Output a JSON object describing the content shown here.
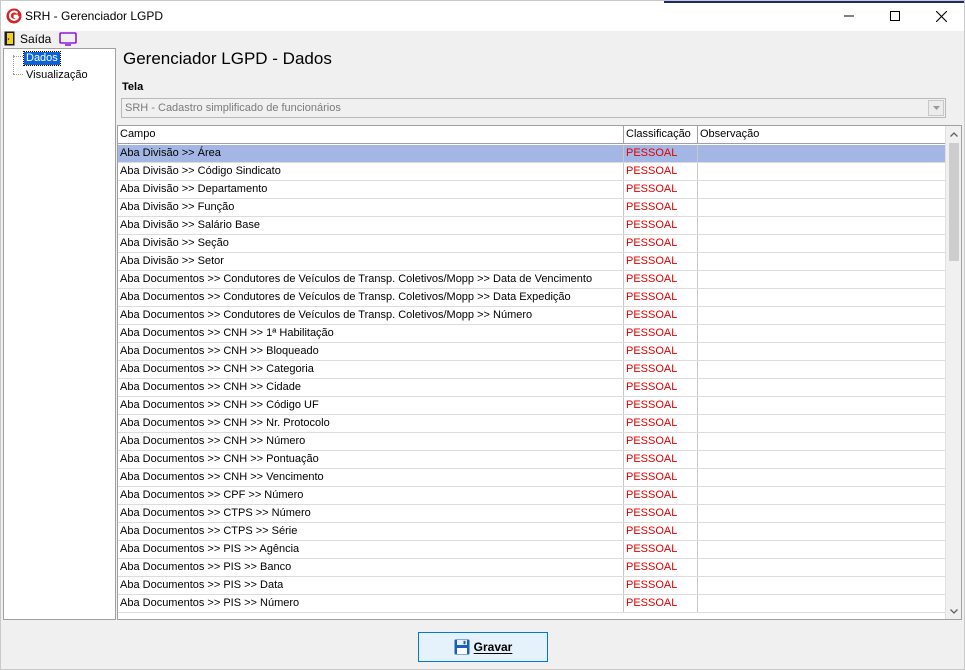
{
  "window": {
    "title": "SRH - Gerenciador LGPD"
  },
  "menu": {
    "exit_label": "Saída"
  },
  "tree": {
    "items": [
      "Dados",
      "Visualização"
    ],
    "selected": "Dados"
  },
  "main": {
    "title": "Gerenciador LGPD - Dados",
    "screen_label": "Tela",
    "screen_value": "SRH - Cadastro simplificado de funcionários"
  },
  "grid": {
    "columns": [
      "Campo",
      "Classificação",
      "Observação"
    ],
    "rows": [
      {
        "campo": "Aba Divisão >> Área",
        "classificacao": "PESSOAL",
        "observacao": ""
      },
      {
        "campo": "Aba Divisão >> Código Sindicato",
        "classificacao": "PESSOAL",
        "observacao": ""
      },
      {
        "campo": "Aba Divisão >> Departamento",
        "classificacao": "PESSOAL",
        "observacao": ""
      },
      {
        "campo": "Aba Divisão >> Função",
        "classificacao": "PESSOAL",
        "observacao": ""
      },
      {
        "campo": "Aba Divisão >> Salário Base",
        "classificacao": "PESSOAL",
        "observacao": ""
      },
      {
        "campo": "Aba Divisão >> Seção",
        "classificacao": "PESSOAL",
        "observacao": ""
      },
      {
        "campo": "Aba Divisão >> Setor",
        "classificacao": "PESSOAL",
        "observacao": ""
      },
      {
        "campo": "Aba Documentos >>  Condutores de Veículos de Transp. Coletivos/Mopp >> Data de Vencimento",
        "classificacao": "PESSOAL",
        "observacao": ""
      },
      {
        "campo": "Aba Documentos >>  Condutores de Veículos de Transp. Coletivos/Mopp >> Data Expedição",
        "classificacao": "PESSOAL",
        "observacao": ""
      },
      {
        "campo": "Aba Documentos >>  Condutores de Veículos de Transp. Coletivos/Mopp >> Número",
        "classificacao": "PESSOAL",
        "observacao": ""
      },
      {
        "campo": "Aba Documentos >> CNH >> 1ª Habilitação",
        "classificacao": "PESSOAL",
        "observacao": ""
      },
      {
        "campo": "Aba Documentos >> CNH >> Bloqueado",
        "classificacao": "PESSOAL",
        "observacao": ""
      },
      {
        "campo": "Aba Documentos >> CNH >> Categoria",
        "classificacao": "PESSOAL",
        "observacao": ""
      },
      {
        "campo": "Aba Documentos >> CNH >> Cidade",
        "classificacao": "PESSOAL",
        "observacao": ""
      },
      {
        "campo": "Aba Documentos >> CNH >> Código UF",
        "classificacao": "PESSOAL",
        "observacao": ""
      },
      {
        "campo": "Aba Documentos >> CNH >> Nr. Protocolo",
        "classificacao": "PESSOAL",
        "observacao": ""
      },
      {
        "campo": "Aba Documentos >> CNH >> Número",
        "classificacao": "PESSOAL",
        "observacao": ""
      },
      {
        "campo": "Aba Documentos >> CNH >> Pontuação",
        "classificacao": "PESSOAL",
        "observacao": ""
      },
      {
        "campo": "Aba Documentos >> CNH >> Vencimento",
        "classificacao": "PESSOAL",
        "observacao": ""
      },
      {
        "campo": "Aba Documentos >> CPF >> Número",
        "classificacao": "PESSOAL",
        "observacao": ""
      },
      {
        "campo": "Aba Documentos >> CTPS >> Número",
        "classificacao": "PESSOAL",
        "observacao": ""
      },
      {
        "campo": "Aba Documentos >> CTPS >> Série",
        "classificacao": "PESSOAL",
        "observacao": ""
      },
      {
        "campo": "Aba Documentos >> PIS >> Agência",
        "classificacao": "PESSOAL",
        "observacao": ""
      },
      {
        "campo": "Aba Documentos >> PIS >> Banco",
        "classificacao": "PESSOAL",
        "observacao": ""
      },
      {
        "campo": "Aba Documentos >> PIS >> Data",
        "classificacao": "PESSOAL",
        "observacao": ""
      },
      {
        "campo": "Aba Documentos >> PIS >> Número",
        "classificacao": "PESSOAL",
        "observacao": ""
      }
    ],
    "selected_row": 0
  },
  "actions": {
    "save_label": "Gravar"
  },
  "colors": {
    "classification_text": "#e00000",
    "selected_row": "#a3b6e4",
    "tree_selected": "#0a64d8",
    "button_border": "#0078d7"
  },
  "icons": {
    "app": "srh-logo-icon",
    "exit": "door-exit-icon",
    "monitor": "monitor-icon",
    "save": "floppy-disk-icon"
  }
}
